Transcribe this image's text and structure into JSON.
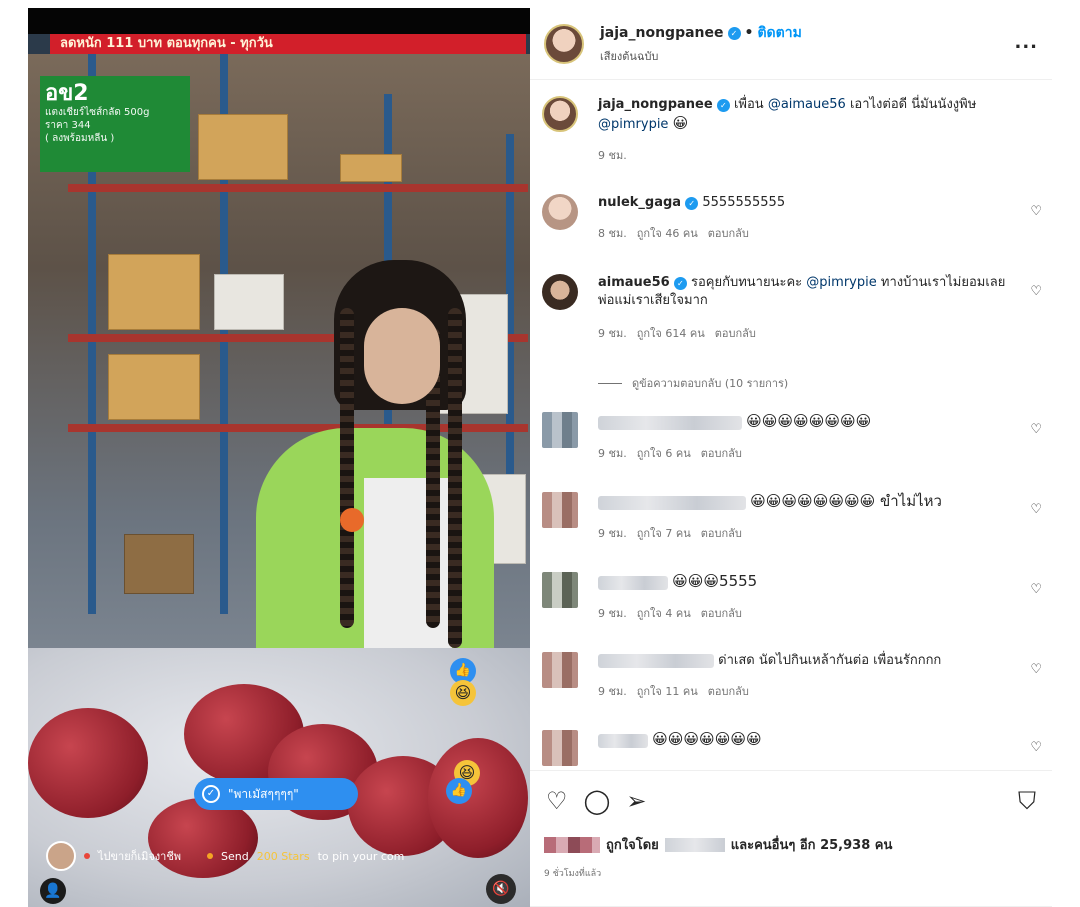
{
  "header": {
    "username": "jaja_nongpanee",
    "follow_label": "ติดตาม",
    "audio_label": "เสียงต้นฉบับ",
    "more_label": "..."
  },
  "video": {
    "banner_text": "ลดหนัก 111 บาท ตอนทุกคน - ทุกวัน",
    "sign_code": "อข2",
    "sign_line1": "แตงเชียร์ไซส์กลัด 500g",
    "sign_line2": "ราคา 344",
    "sign_line3": "( ลงพร้อมหลีน )",
    "pill_text": "\"พาเมัสๆๆๆๆ\"",
    "bottom_name": "ไปขายก็เมิจงาชีพ",
    "bottom_send_prefix": "Send",
    "bottom_stars": "200 Stars",
    "bottom_send_suffix": "to pin your com"
  },
  "caption": {
    "username": "jaja_nongpanee",
    "text": "เพื่อน",
    "mention1": "@aimaue56",
    "text2": "เอาไงต่อดี นี่มันนังงูพิษ",
    "mention2": "@pimrypie",
    "emoji": "😀",
    "time": "9 ชม."
  },
  "comments": [
    {
      "username": "nulek_gaga",
      "text": "5555555555",
      "time": "8 ชม.",
      "likes": "ถูกใจ 46 คน",
      "reply": "ตอบกลับ"
    },
    {
      "username": "aimaue56",
      "text_pre": "รอคุยกับทนายนะคะ",
      "mention": "@pimrypie",
      "text_post": "ทางบ้านเราไม่ยอมเลย พ่อแม่เราเสียใจมาก",
      "time": "9 ชม.",
      "likes": "ถูกใจ 614 คน",
      "reply": "ตอบกลับ",
      "view_replies": "ดูข้อความตอบกลับ (10 รายการ)"
    },
    {
      "text": "😀😀😀😀😀😀😀😀",
      "time": "9 ชม.",
      "likes": "ถูกใจ 6 คน",
      "reply": "ตอบกลับ"
    },
    {
      "text": "😀😀😀😀😀😀😀😀 ขำไม่ไหว",
      "time": "9 ชม.",
      "likes": "ถูกใจ 7 คน",
      "reply": "ตอบกลับ"
    },
    {
      "text": "😀😀😀5555",
      "time": "9 ชม.",
      "likes": "ถูกใจ 4 คน",
      "reply": "ตอบกลับ"
    },
    {
      "text": "ด่าเสด นัดไปกินเหล้ากันต่อ เพื่อนรักกกก",
      "time": "9 ชม.",
      "likes": "ถูกใจ 11 คน",
      "reply": "ตอบกลับ"
    },
    {
      "text": "😀😀😀😀😀😀😀"
    }
  ],
  "footer": {
    "liked_by": "ถูกใจโดย",
    "and_others": "และคนอื่นๆ อีก 25,938 คน",
    "timestamp": "9 ชั่วโมงที่แล้ว"
  },
  "colors": {
    "verified": "#1d9bf0",
    "follow": "#0095f6",
    "live_pill": "#2e8ff0",
    "banner": "#d21f2a",
    "sign": "#1f8a36"
  }
}
